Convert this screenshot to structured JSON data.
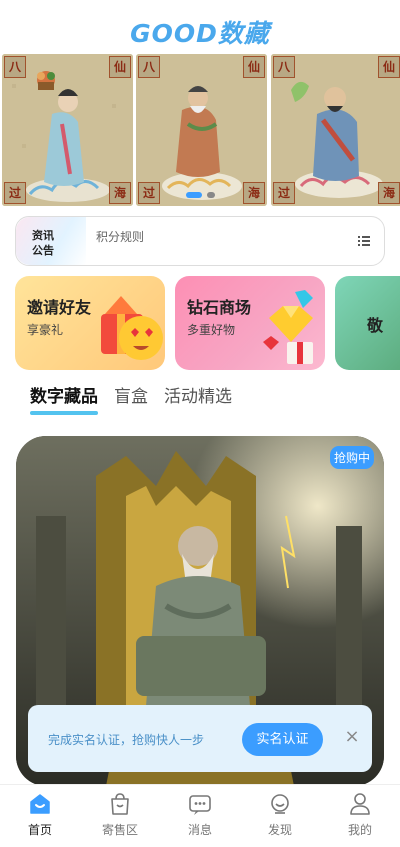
{
  "app": {
    "title": "GOOD数藏"
  },
  "banner": {
    "panels": [
      {
        "corners": [
          "八",
          "仙",
          "过",
          "海"
        ]
      },
      {
        "corners": [
          "八",
          "仙",
          "过",
          "海"
        ]
      },
      {
        "corners": [
          "八",
          "仙",
          "过",
          "海"
        ]
      }
    ],
    "active_slide_index": 0,
    "slide_count": 2
  },
  "notice": {
    "tag_line1": "资讯",
    "tag_line2": "公告",
    "text": "积分规则"
  },
  "promos": [
    {
      "title": "邀请好友",
      "subtitle": "享豪礼"
    },
    {
      "title": "钻石商场",
      "subtitle": "多重好物"
    },
    {
      "title": "敬"
    }
  ],
  "tabs": [
    {
      "label": "数字藏品",
      "active": true
    },
    {
      "label": "盲盒",
      "active": false
    },
    {
      "label": "活动精选",
      "active": false
    }
  ],
  "card": {
    "badge": "抢购中"
  },
  "verify": {
    "text": "完成实名认证，抢购快人一步",
    "button": "实名认证",
    "close": "×"
  },
  "tabbar": [
    {
      "label": "首页",
      "icon": "home-icon",
      "active": true
    },
    {
      "label": "寄售区",
      "icon": "shopping-bag-icon",
      "active": false
    },
    {
      "label": "消息",
      "icon": "message-icon",
      "active": false
    },
    {
      "label": "发现",
      "icon": "discover-icon",
      "active": false
    },
    {
      "label": "我的",
      "icon": "profile-icon",
      "active": false
    }
  ],
  "colors": {
    "accent": "#3b9dff",
    "tab_underline": "#53c3ef",
    "title": "#4aa8ec"
  }
}
